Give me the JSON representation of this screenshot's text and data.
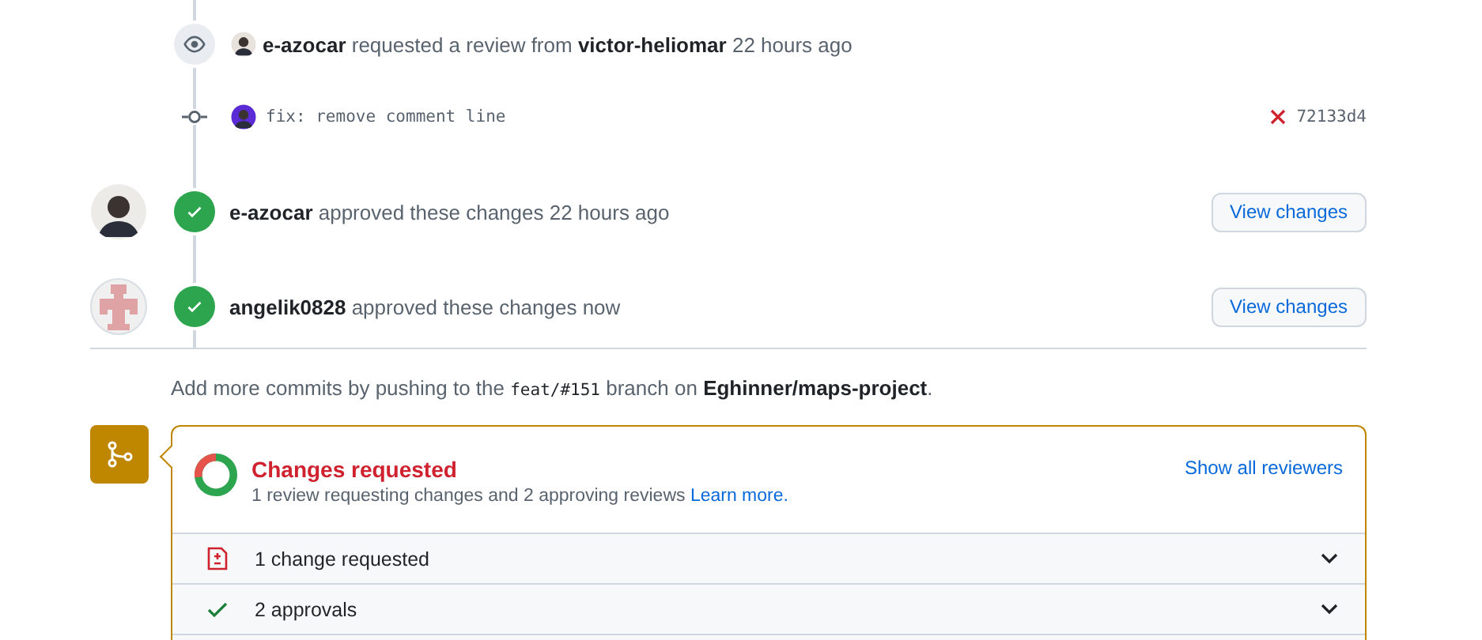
{
  "timeline": [
    {
      "kind": "review_request",
      "actor": "e-azocar",
      "action": "requested a review from",
      "target": "victor-heliomar",
      "time": "22 hours ago"
    },
    {
      "kind": "commit",
      "message": "fix: remove comment line",
      "checks_failed": true,
      "sha": "72133d4"
    },
    {
      "kind": "approval",
      "avatar": {
        "kind": "photo"
      },
      "actor": "e-azocar",
      "action": "approved these changes",
      "time": "22 hours ago",
      "button": "View changes"
    },
    {
      "kind": "approval",
      "avatar": {
        "kind": "identicon"
      },
      "actor": "angelik0828",
      "action": "approved these changes",
      "time": "now",
      "button": "View changes"
    }
  ],
  "push_hint": {
    "before": "Add more commits by pushing to the",
    "branch": "feat/#151",
    "middle": "branch on",
    "repo": "Eghinner/maps-project",
    "after": "."
  },
  "merge_box": {
    "status": "Changes requested",
    "summary": "1 review requesting changes and 2 approving reviews",
    "learn_more": "Learn more.",
    "show_all": "Show all reviewers",
    "sections": [
      {
        "kind": "changes_requested",
        "label": "1 change requested"
      },
      {
        "kind": "approved",
        "label": "2 approvals"
      }
    ]
  }
}
